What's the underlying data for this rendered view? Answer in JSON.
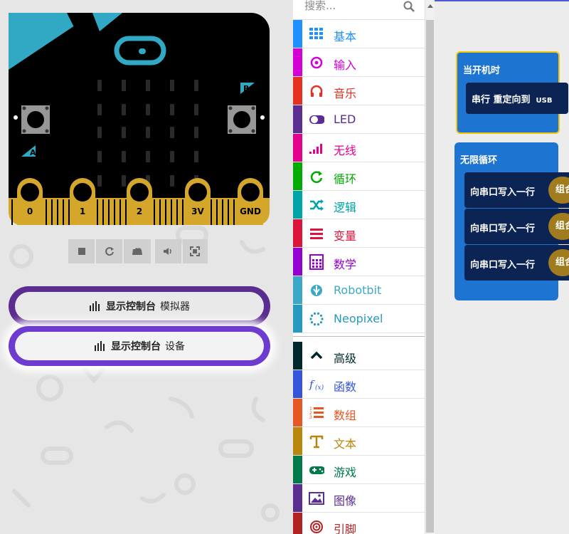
{
  "simulator": {
    "pins": [
      "0",
      "1",
      "2",
      "3V",
      "GND"
    ],
    "button_a": "A",
    "button_b": "B",
    "toolbar": [
      {
        "name": "stop-button",
        "icon": "stop-icon"
      },
      {
        "name": "restart-button",
        "icon": "restart-icon"
      },
      {
        "name": "slow-motion-button",
        "icon": "snail-icon"
      },
      {
        "name": "mute-button",
        "icon": "volume-icon"
      },
      {
        "name": "fullscreen-button",
        "icon": "fullscreen-icon"
      }
    ],
    "console_simulator": {
      "strong": "显示控制台",
      "suffix": "模拟器"
    },
    "console_device": {
      "strong": "显示控制台",
      "suffix": "设备"
    }
  },
  "toolbox": {
    "search_placeholder": "搜索...",
    "categories": [
      {
        "label": "基本",
        "color": "#1e90ff",
        "icon": "grid-icon"
      },
      {
        "label": "输入",
        "color": "#d400d4",
        "icon": "target-icon"
      },
      {
        "label": "音乐",
        "color": "#e63022",
        "icon": "headphones-icon"
      },
      {
        "label": "LED",
        "color": "#5c2d91",
        "icon": "toggle-icon"
      },
      {
        "label": "无线",
        "color": "#e3008c",
        "icon": "signal-icon"
      },
      {
        "label": "循环",
        "color": "#00aa00",
        "icon": "refresh-icon"
      },
      {
        "label": "逻辑",
        "color": "#00a4a6",
        "icon": "shuffle-icon"
      },
      {
        "label": "变量",
        "color": "#dc143c",
        "icon": "list-icon"
      },
      {
        "label": "数学",
        "color": "#9400d3",
        "icon": "calculator-icon"
      },
      {
        "label": "Robotbit",
        "color": "#3ca8c8",
        "icon": "rebel-icon"
      },
      {
        "label": "Neopixel",
        "color": "#2699bf",
        "icon": "ring-icon"
      }
    ],
    "advanced": [
      {
        "label": "高级",
        "color": "#00272b",
        "icon": "chevron-up-icon"
      },
      {
        "label": "函数",
        "color": "#3455db",
        "icon": "function-icon"
      },
      {
        "label": "数组",
        "color": "#e65722",
        "icon": "numbered-list-icon"
      },
      {
        "label": "文本",
        "color": "#b8860b",
        "icon": "text-icon"
      },
      {
        "label": "游戏",
        "color": "#007a4b",
        "icon": "gamepad-icon"
      },
      {
        "label": "图像",
        "color": "#5c2d91",
        "icon": "image-icon"
      },
      {
        "label": "引脚",
        "color": "#b22222",
        "icon": "bullseye-icon"
      }
    ]
  },
  "workspace": {
    "on_start_label": "当开机时",
    "on_start_stmt": "串行 重定向到",
    "on_start_usb": "USB",
    "forever_label": "无限循环",
    "forever_stmts": [
      "向串口写入一行",
      "向串口写入一行",
      "向串口写入一行"
    ],
    "pill_text": "组合"
  }
}
